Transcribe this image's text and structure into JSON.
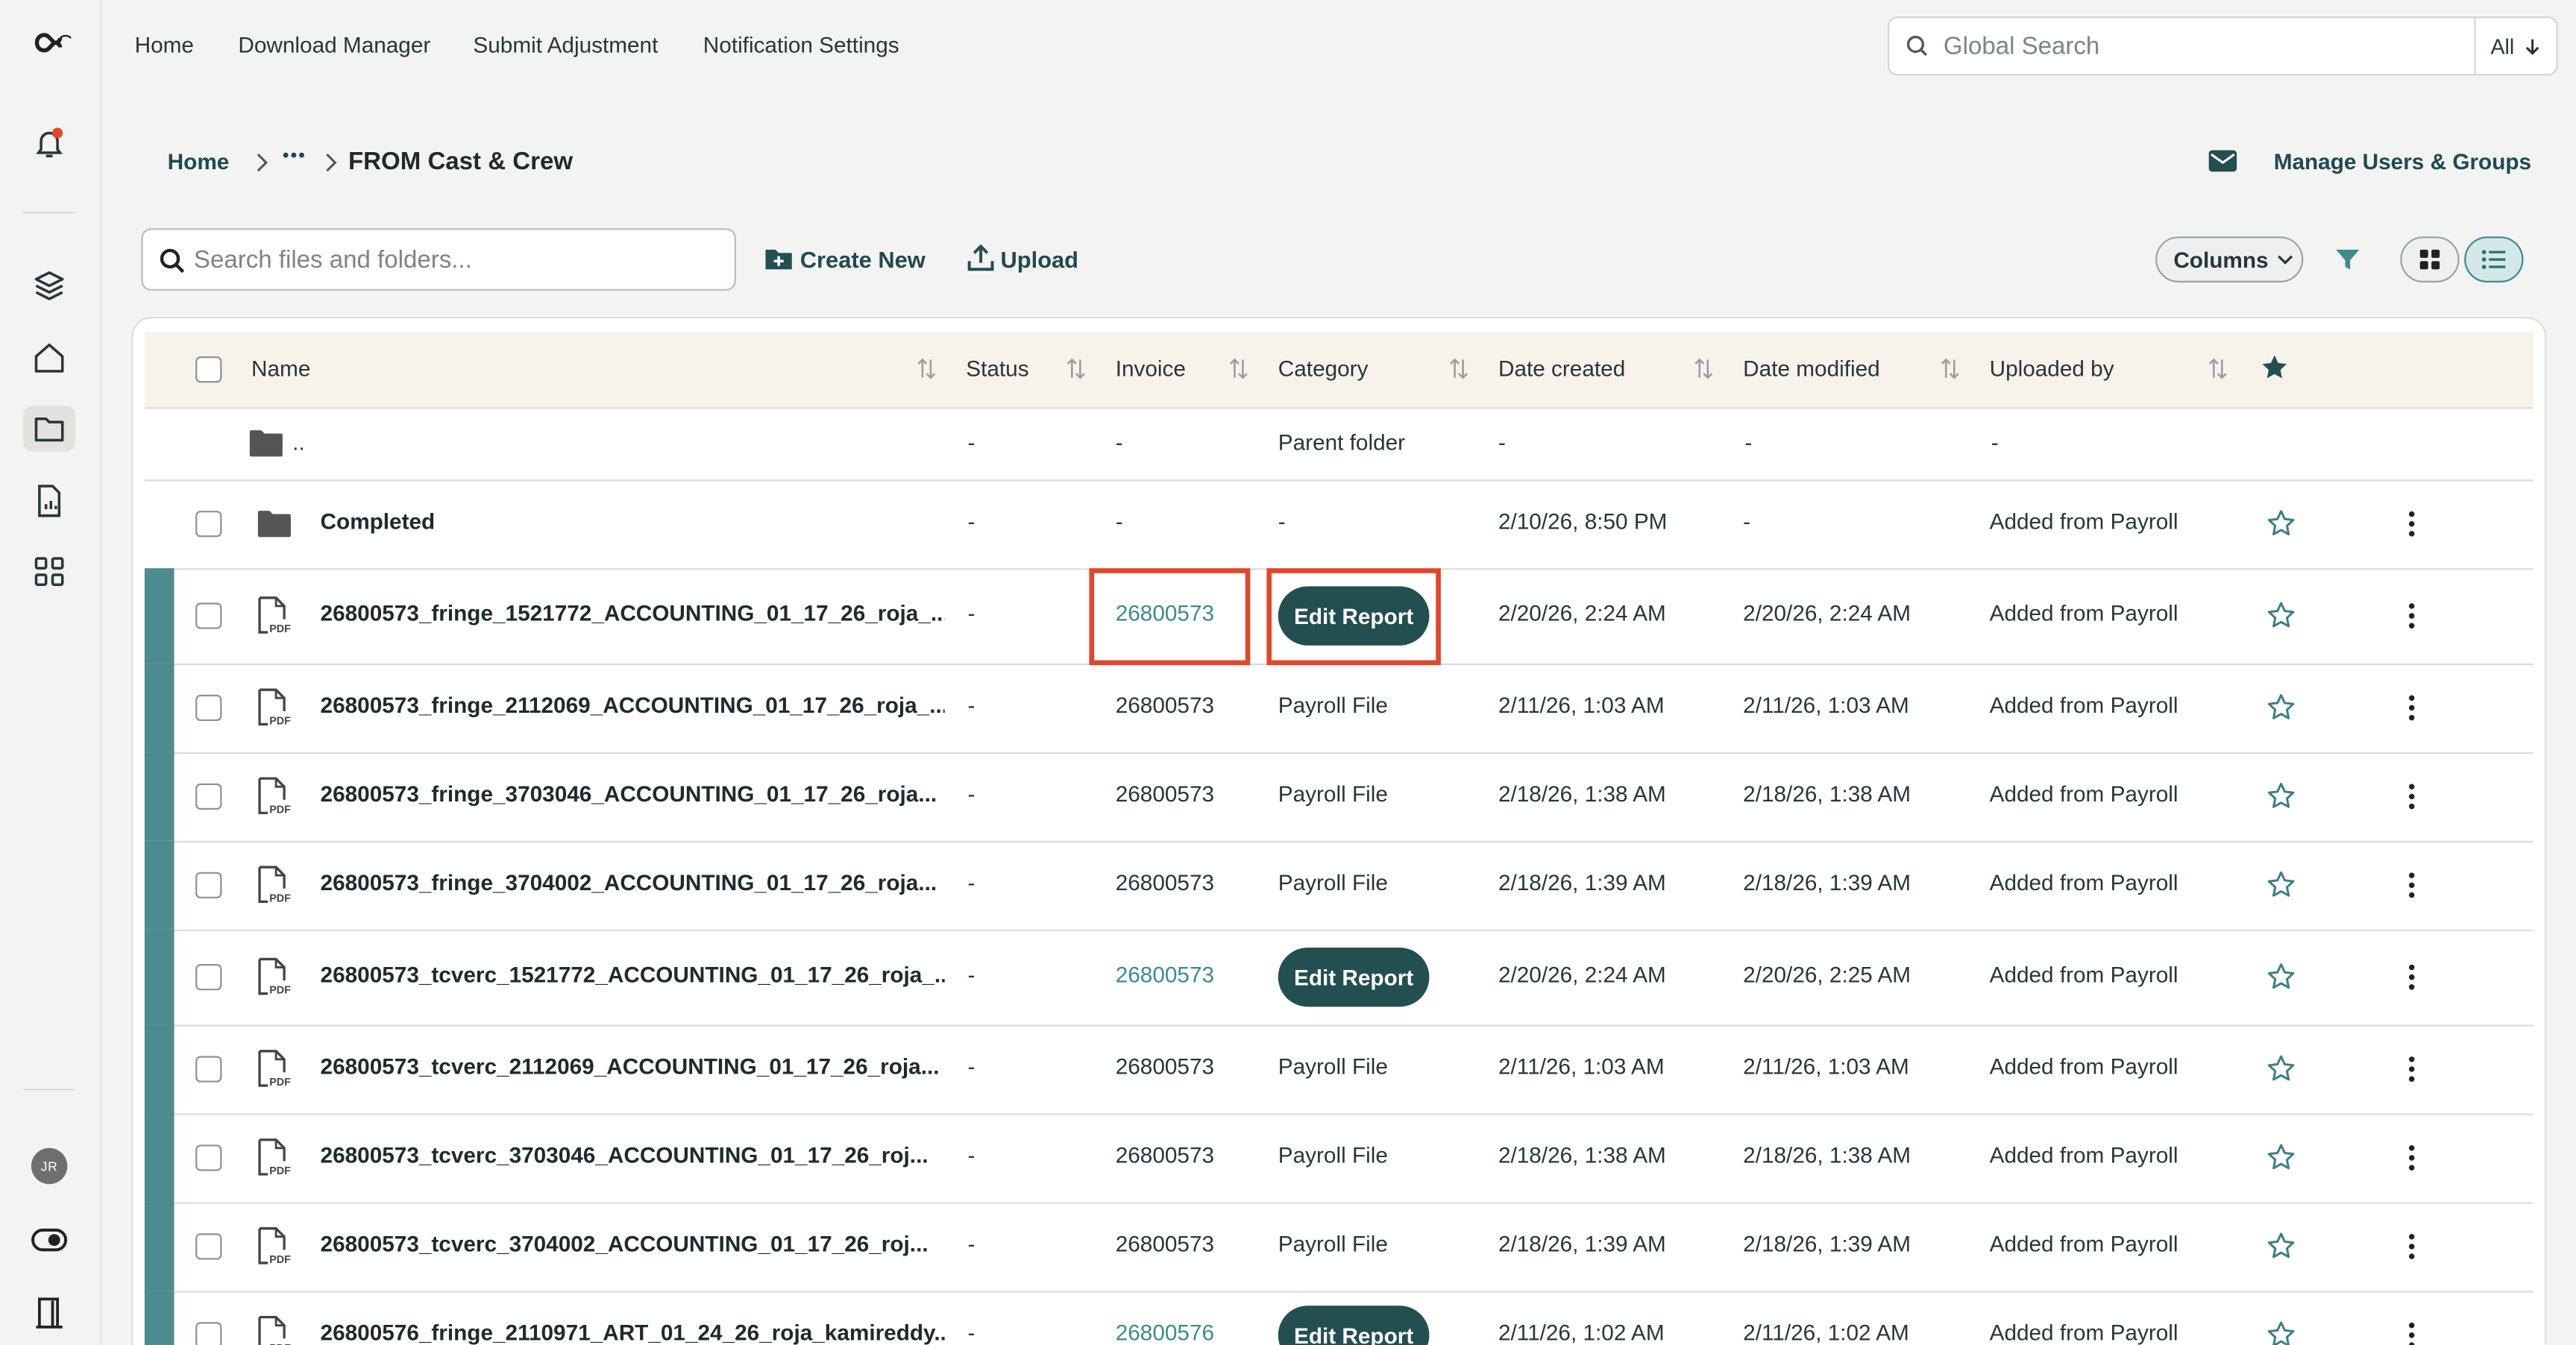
{
  "nav": {
    "home": "Home",
    "download_manager": "Download Manager",
    "submit_adjustment": "Submit Adjustment",
    "notification_settings": "Notification Settings"
  },
  "global_search": {
    "placeholder": "Global Search",
    "scope": "All"
  },
  "rail": {
    "avatar_initials": "JR",
    "icons": [
      "logo-icon",
      "bell-icon",
      "layers-icon",
      "home-icon",
      "folder-icon",
      "report-icon",
      "apps-icon",
      "toggle-icon",
      "door-icon"
    ]
  },
  "breadcrumb": {
    "home": "Home",
    "ellipsis": "•••",
    "current": "FROM Cast & Crew"
  },
  "manage_users": "Manage Users & Groups",
  "toolbar": {
    "search_placeholder": "Search files and folders...",
    "create_new": "Create New",
    "upload": "Upload",
    "columns": "Columns"
  },
  "table": {
    "headers": {
      "name": "Name",
      "status": "Status",
      "invoice": "Invoice",
      "category": "Category",
      "created": "Date created",
      "modified": "Date modified",
      "uploaded_by": "Uploaded by"
    },
    "parent": {
      "name": "..",
      "status": "-",
      "invoice": "-",
      "category": "Parent folder",
      "created": "-",
      "modified": "-",
      "uploaded_by": "-"
    },
    "rows": [
      {
        "name": "Completed",
        "status": "-",
        "invoice": "-",
        "category": "-",
        "created": "2/10/26, 8:50 PM",
        "modified": "-",
        "uploaded_by": "Added from Payroll"
      },
      {
        "name": "26800573_fringe_1521772_ACCOUNTING_01_17_26_roja_...",
        "status": "-",
        "invoice": "26800573",
        "category": "Edit Report",
        "created": "2/20/26, 2:24 AM",
        "modified": "2/20/26, 2:24 AM",
        "uploaded_by": "Added from Payroll"
      },
      {
        "name": "26800573_fringe_2112069_ACCOUNTING_01_17_26_roja_...",
        "status": "-",
        "invoice": "26800573",
        "category": "Payroll File",
        "created": "2/11/26, 1:03 AM",
        "modified": "2/11/26, 1:03 AM",
        "uploaded_by": "Added from Payroll"
      },
      {
        "name": "26800573_fringe_3703046_ACCOUNTING_01_17_26_roja...",
        "status": "-",
        "invoice": "26800573",
        "category": "Payroll File",
        "created": "2/18/26, 1:38 AM",
        "modified": "2/18/26, 1:38 AM",
        "uploaded_by": "Added from Payroll"
      },
      {
        "name": "26800573_fringe_3704002_ACCOUNTING_01_17_26_roja...",
        "status": "-",
        "invoice": "26800573",
        "category": "Payroll File",
        "created": "2/18/26, 1:39 AM",
        "modified": "2/18/26, 1:39 AM",
        "uploaded_by": "Added from Payroll"
      },
      {
        "name": "26800573_tcverc_1521772_ACCOUNTING_01_17_26_roja_...",
        "status": "-",
        "invoice": "26800573",
        "category": "Edit Report",
        "created": "2/20/26, 2:24 AM",
        "modified": "2/20/26, 2:25 AM",
        "uploaded_by": "Added from Payroll"
      },
      {
        "name": "26800573_tcverc_2112069_ACCOUNTING_01_17_26_roja...",
        "status": "-",
        "invoice": "26800573",
        "category": "Payroll File",
        "created": "2/11/26, 1:03 AM",
        "modified": "2/11/26, 1:03 AM",
        "uploaded_by": "Added from Payroll"
      },
      {
        "name": "26800573_tcverc_3703046_ACCOUNTING_01_17_26_roj...",
        "status": "-",
        "invoice": "26800573",
        "category": "Payroll File",
        "created": "2/18/26, 1:38 AM",
        "modified": "2/18/26, 1:38 AM",
        "uploaded_by": "Added from Payroll"
      },
      {
        "name": "26800573_tcverc_3704002_ACCOUNTING_01_17_26_roj...",
        "status": "-",
        "invoice": "26800573",
        "category": "Payroll File",
        "created": "2/18/26, 1:39 AM",
        "modified": "2/18/26, 1:39 AM",
        "uploaded_by": "Added from Payroll"
      },
      {
        "name": "26800576_fringe_2110971_ART_01_24_26_roja_kamireddy...",
        "status": "-",
        "invoice": "26800576",
        "category": "Edit Report",
        "created": "2/11/26, 1:02 AM",
        "modified": "2/11/26, 1:02 AM",
        "uploaded_by": "Added from Payroll"
      }
    ]
  },
  "colors": {
    "accent": "#234f50",
    "link": "#3d8a8c",
    "row_marker": "#4d8c8d",
    "highlight": "#e2462b",
    "notification_dot": "#e2462b"
  }
}
